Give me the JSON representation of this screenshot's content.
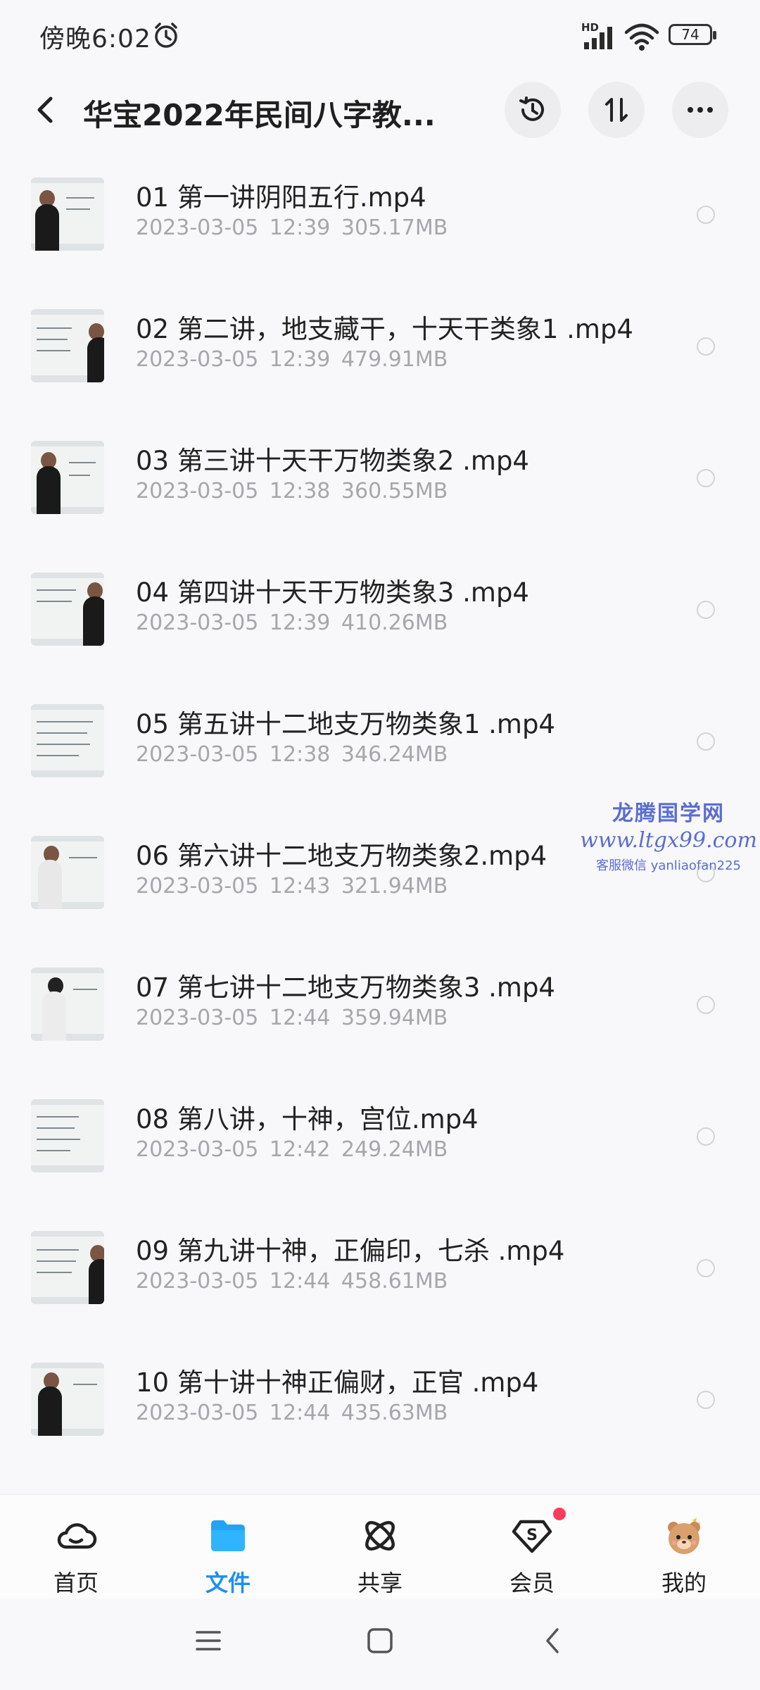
{
  "status_bar": {
    "time": "傍晚6:02",
    "network": "HD",
    "battery": "74"
  },
  "header": {
    "title": "华宝2022年民间八字教..."
  },
  "files": [
    {
      "name": "01 第一讲阴阳五行.mp4",
      "date": "2023-03-05",
      "time": "12:39",
      "size": "305.17MB"
    },
    {
      "name": "02 第二讲，地支藏干，十天干类象1 .mp4",
      "date": "2023-03-05",
      "time": "12:39",
      "size": "479.91MB"
    },
    {
      "name": "03 第三讲十天干万物类象2 .mp4",
      "date": "2023-03-05",
      "time": "12:38",
      "size": "360.55MB"
    },
    {
      "name": "04 第四讲十天干万物类象3 .mp4",
      "date": "2023-03-05",
      "time": "12:39",
      "size": "410.26MB"
    },
    {
      "name": "05 第五讲十二地支万物类象1 .mp4",
      "date": "2023-03-05",
      "time": "12:38",
      "size": "346.24MB"
    },
    {
      "name": "06 第六讲十二地支万物类象2.mp4",
      "date": "2023-03-05",
      "time": "12:43",
      "size": "321.94MB"
    },
    {
      "name": "07 第七讲十二地支万物类象3 .mp4",
      "date": "2023-03-05",
      "time": "12:44",
      "size": "359.94MB"
    },
    {
      "name": "08 第八讲，十神，宫位.mp4",
      "date": "2023-03-05",
      "time": "12:42",
      "size": "249.24MB"
    },
    {
      "name": "09 第九讲十神，正偏印，七杀 .mp4",
      "date": "2023-03-05",
      "time": "12:44",
      "size": "458.61MB"
    },
    {
      "name": "10 第十讲十神正偏财，正官 .mp4",
      "date": "2023-03-05",
      "time": "12:44",
      "size": "435.63MB"
    }
  ],
  "watermark": {
    "line1": "龙腾国学网",
    "line2": "www.ltgx99.com",
    "line3": "客服微信 yanliaofan225"
  },
  "bottom_nav": [
    {
      "label": "首页",
      "icon": "cloud-icon",
      "active": false
    },
    {
      "label": "文件",
      "icon": "folder-icon",
      "active": true
    },
    {
      "label": "共享",
      "icon": "share-atom-icon",
      "active": false
    },
    {
      "label": "会员",
      "icon": "vip-diamond-icon",
      "active": false,
      "badge": true
    },
    {
      "label": "我的",
      "icon": "bear-avatar-icon",
      "active": false
    }
  ],
  "colors": {
    "accent": "#1e90f0",
    "badge": "#ff3b5c",
    "meta_text": "#a7a7ab"
  }
}
